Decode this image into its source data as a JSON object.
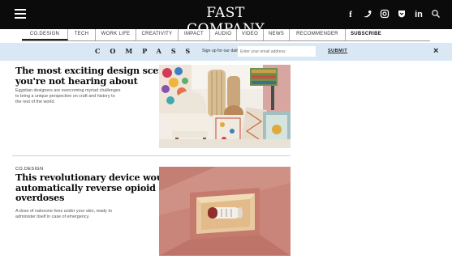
{
  "header": {
    "logo_text": "FAST COMPANY",
    "menu_icon": "hamburger-icon",
    "social_icons": [
      "facebook-icon",
      "twitter-icon",
      "instagram-icon",
      "flipboard-icon",
      "linkedin-icon",
      "search-icon"
    ]
  },
  "nav": {
    "items": [
      {
        "label": "CO.DESIGN",
        "active": true
      },
      {
        "label": "TECH",
        "active": false
      },
      {
        "label": "WORK LIFE",
        "active": false
      },
      {
        "label": "CREATIVITY",
        "active": false
      },
      {
        "label": "IMPACT",
        "active": false
      },
      {
        "label": "AUDIO",
        "active": false
      },
      {
        "label": "VIDEO",
        "active": false
      },
      {
        "label": "NEWS",
        "active": false
      },
      {
        "label": "RECOMMENDER",
        "active": false
      },
      {
        "label": "SUBSCRIBE",
        "active": false
      }
    ]
  },
  "compass": {
    "brand": "COMPASS",
    "signup_text": "Sign up for our daily email",
    "email_placeholder": "Enter your email address",
    "submit_label": "SUBMIT",
    "close_label": "×"
  },
  "articles": [
    {
      "kicker": "",
      "title_lines": [
        "The most exciting design scene",
        "you're not hearing about"
      ],
      "dek_lines": [
        "Egyptian designers are overcoming myriad challenges",
        "to bring a unique perspective on craft and history to",
        "the rest of the world."
      ],
      "image": "colorful-furniture-photo"
    },
    {
      "kicker": "CO.DESIGN",
      "title_lines": [
        "This revolutionary device would",
        "automatically reverse opioid",
        "overdoses"
      ],
      "dek_lines": [
        "A dose of naloxone lives under your skin, ready to",
        "administer itself in case of emergency."
      ],
      "image": "implant-device-illustration"
    }
  ],
  "colors": {
    "header_bg": "#0b0b0b",
    "banner_bg": "#d9e8f4",
    "image_pink": "#c98579"
  }
}
